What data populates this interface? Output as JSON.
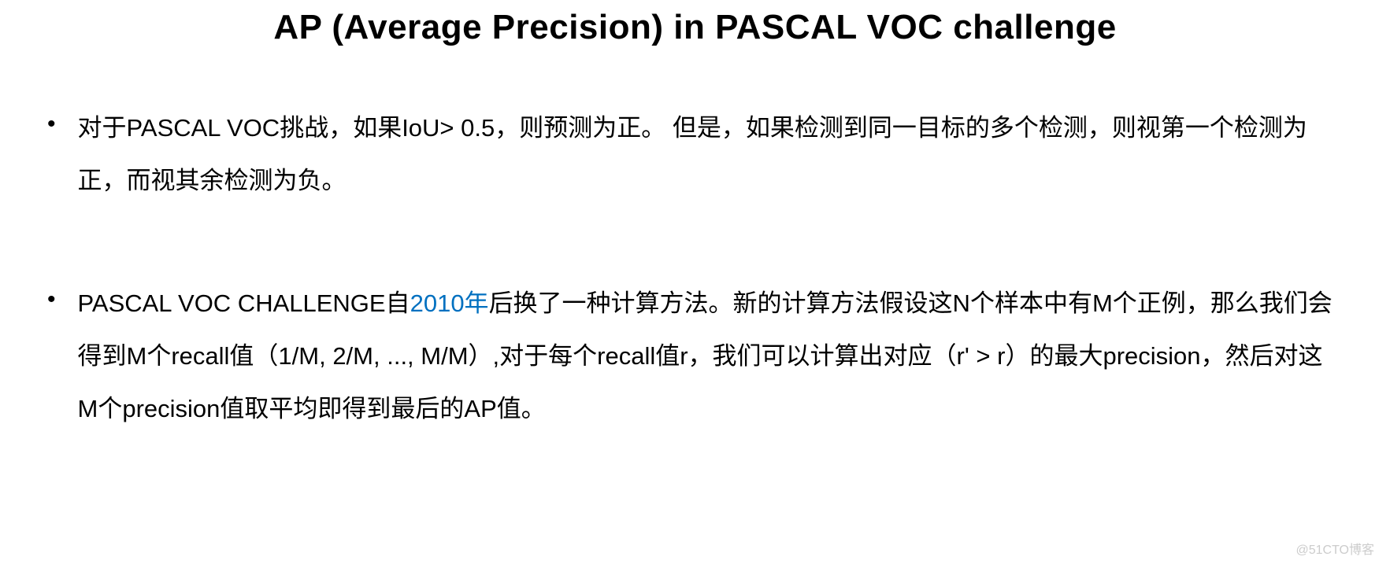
{
  "title": "AP (Average Precision) in PASCAL VOC challenge",
  "bullets": [
    {
      "parts": [
        {
          "text": "对于PASCAL VOC挑战，如果IoU> 0.5，则预测为正。 但是，如果检测到同一目标的多个检测，则视第一个检测为正，而视其余检测为负。",
          "highlight": false
        }
      ]
    },
    {
      "parts": [
        {
          "text": "PASCAL VOC CHALLENGE自",
          "highlight": false
        },
        {
          "text": "2010年",
          "highlight": true
        },
        {
          "text": "后换了一种计算方法。新的计算方法假设这N个样本中有M个正例，那么我们会得到M个recall值（1/M, 2/M, ..., M/M）,对于每个recall值r，我们可以计算出对应（r' > r）的最大precision，然后对这M个precision值取平均即得到最后的AP值。",
          "highlight": false
        }
      ]
    }
  ],
  "watermark": "@51CTO博客"
}
